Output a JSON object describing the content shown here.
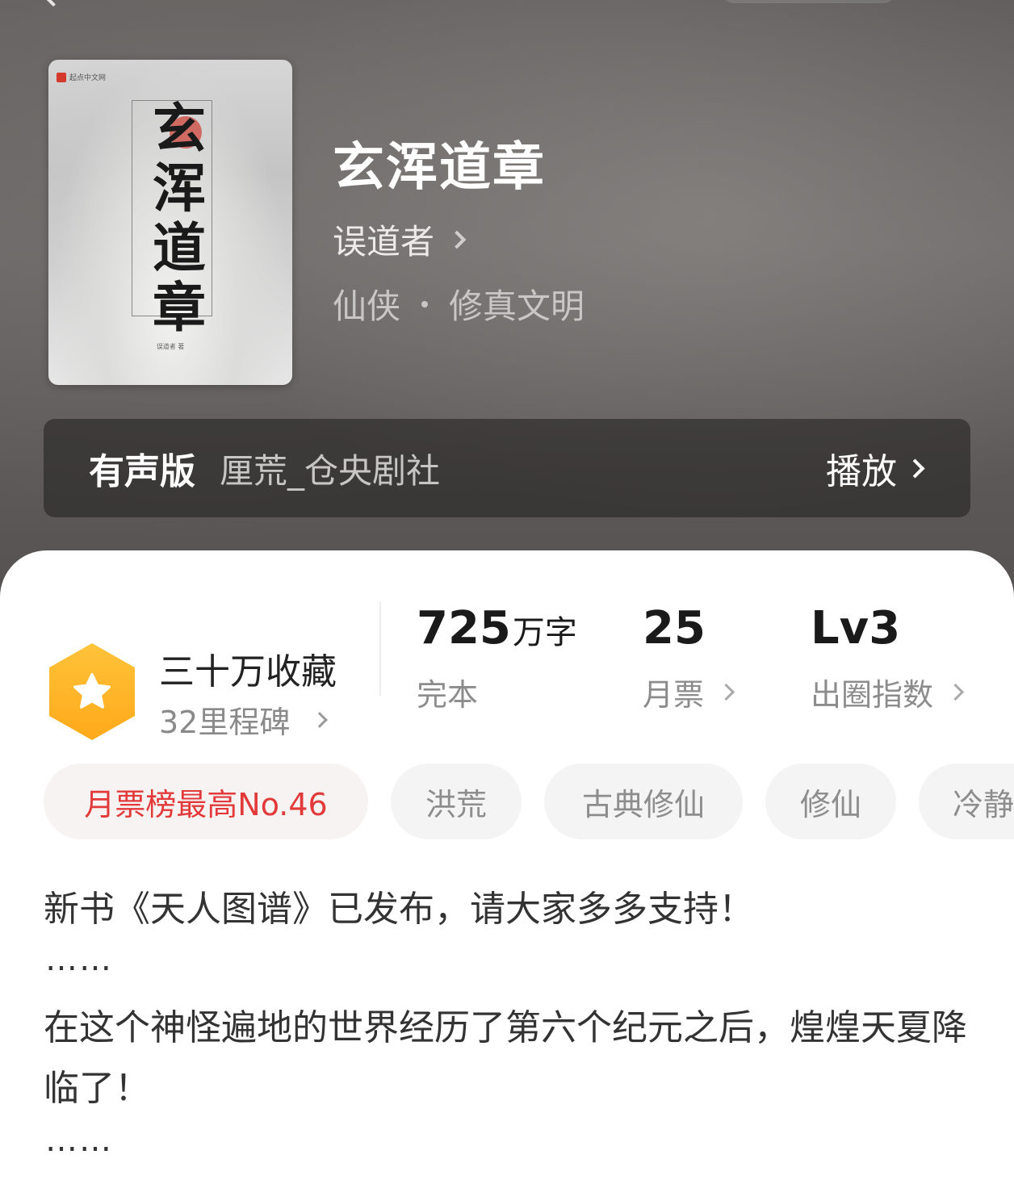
{
  "book": {
    "title": "玄浑道章",
    "author": "误道者",
    "category": "仙侠",
    "subcategory": "修真文明",
    "cover": {
      "title_art": "玄浑道章",
      "publisher_mark": "起点中文网",
      "author_mark": "误道者 著"
    }
  },
  "audio": {
    "label": "有声版",
    "narrator": "厘荒_仓央剧社",
    "action": "播放"
  },
  "collection": {
    "title": "三十万收藏",
    "milestone": "32里程碑"
  },
  "stats": [
    {
      "value": "725",
      "unit": "万字",
      "label": "完本"
    },
    {
      "value": "25",
      "unit": "",
      "label": "月票"
    },
    {
      "value": "Lv3",
      "unit": "",
      "label": "出圈指数"
    }
  ],
  "tags": [
    "月票榜最高No.46",
    "洪荒",
    "古典修仙",
    "修仙",
    "冷静"
  ],
  "description": {
    "line1": "新书《天人图谱》已发布，请大家多多支持！",
    "ellipsis": "……",
    "line2": "在这个神怪遍地的世界经历了第六个纪元之后，煌煌天夏降临了！"
  },
  "colors": {
    "accent_red": "#e23a3a",
    "badge_orange": "#ffb020",
    "hero_bg": "#5f5c5b"
  }
}
